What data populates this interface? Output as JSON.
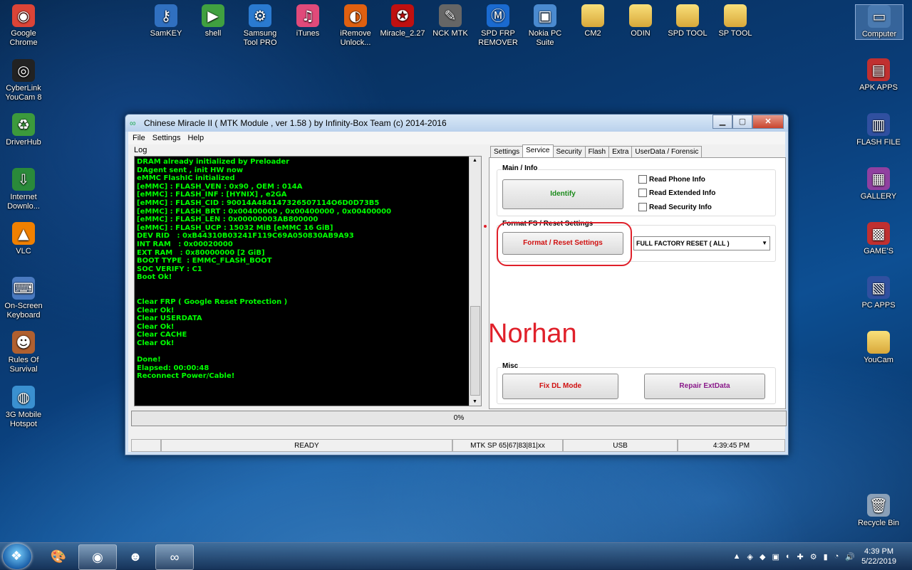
{
  "desktop": {
    "left_icons": [
      {
        "label": "Google Chrome",
        "glyph": "◉",
        "color": "#db4437"
      },
      {
        "label": "CyberLink YouCam 8",
        "glyph": "◎",
        "color": "#222"
      },
      {
        "label": "DriverHub",
        "glyph": "♻",
        "color": "#3c9a3c"
      },
      {
        "label": "Internet Downlo...",
        "glyph": "⇩",
        "color": "#2a8a3a"
      },
      {
        "label": "VLC",
        "glyph": "▲",
        "color": "#f08000"
      },
      {
        "label": "On-Screen Keyboard",
        "glyph": "⌨",
        "color": "#4a7ac0"
      },
      {
        "label": "Rules Of Survival",
        "glyph": "☻",
        "color": "#b06030"
      },
      {
        "label": "3G Mobile Hotspot",
        "glyph": "◍",
        "color": "#3a90d0"
      }
    ],
    "top_icons": [
      {
        "label": "SamKEY",
        "glyph": "⚷",
        "color": "#3070c0"
      },
      {
        "label": "shell",
        "glyph": "▶",
        "color": "#40a040"
      },
      {
        "label": "Samsung Tool PRO",
        "glyph": "⚙",
        "color": "#2a7ad0"
      },
      {
        "label": "iTunes",
        "glyph": "♫",
        "color": "#e04a7a"
      },
      {
        "label": "iRemove Unlock...",
        "glyph": "◐",
        "color": "#e06010"
      },
      {
        "label": "Miracle_2.27",
        "glyph": "✪",
        "color": "#c01010"
      },
      {
        "label": "NCK MTK",
        "glyph": "✎",
        "color": "#666"
      },
      {
        "label": "SPD FRP REMOVER",
        "glyph": "Ⓜ",
        "color": "#1a6ad0"
      },
      {
        "label": "Nokia PC Suite",
        "glyph": "▣",
        "color": "#4a8ad0"
      },
      {
        "label": "CM2",
        "glyph": "",
        "color": "folder"
      },
      {
        "label": "ODIN",
        "glyph": "",
        "color": "folder"
      },
      {
        "label": "SPD TOOL",
        "glyph": "",
        "color": "folder"
      },
      {
        "label": "SP TOOL",
        "glyph": "",
        "color": "folder"
      }
    ],
    "right_icons": [
      {
        "label": "Computer",
        "glyph": "▭",
        "color": "#4a7ab0"
      },
      {
        "label": "APK APPS",
        "glyph": "▤",
        "color": "#c03030"
      },
      {
        "label": "FLASH FILE",
        "glyph": "▥",
        "color": "#3050a0"
      },
      {
        "label": "GALLERY",
        "glyph": "▦",
        "color": "#9040a0"
      },
      {
        "label": "GAME'S",
        "glyph": "▩",
        "color": "#c03030"
      },
      {
        "label": "PC APPS",
        "glyph": "▧",
        "color": "#3050a0"
      },
      {
        "label": "YouCam",
        "glyph": "",
        "color": "folder"
      },
      {
        "label": "Recycle Bin",
        "glyph": "🗑",
        "color": "#8aa0b8"
      }
    ]
  },
  "window": {
    "title": "Chinese Miracle II ( MTK Module , ver 1.58 ) by Infinity-Box Team (c) 2014-2016",
    "menu": [
      "File",
      "Settings",
      "Help"
    ],
    "log_label": "Log",
    "log_lines": [
      "DRAM already initialized by Preloader",
      "DAgent sent , init HW now",
      "eMMC FlashIC initialized",
      "[eMMC] : FLASH_VEN : 0x90 , OEM : 014A",
      "[eMMC] : FLASH_INF : [HYNIX] , e2GA",
      "[eMMC] : FLASH_CID : 90014A484147326507114O6D0D73B5",
      "[eMMC] : FLASH_BRT : 0x00400000 , 0x00400000 , 0x00400000",
      "[eMMC] : FLASH_LEN : 0x00000003AB800000",
      "[eMMC] : FLASH_UCP : 15032 MiB [eMMC 16 GiB]",
      "DEV RID   : 0xB44310B03241F119C69A050830AB9A93",
      "INT RAM   : 0x00020000",
      "EXT RAM   : 0x80000000 [2 GiB]",
      "BOOT TYPE  : EMMC_FLASH_BOOT",
      "SOC VERIFY : C1",
      "Boot Ok!",
      "",
      "",
      "Clear FRP ( Google Reset Protection )",
      "Clear Ok!",
      "Clear USERDATA",
      "Clear Ok!",
      "Clear CACHE",
      "Clear Ok!",
      "",
      "Done!",
      "Elapsed: 00:00:48",
      "Reconnect Power/Cable!"
    ],
    "tabs": [
      "Settings",
      "Service",
      "Security",
      "Flash",
      "Extra",
      "UserData / Forensic"
    ],
    "active_tab": "Service",
    "main_info": {
      "group_label": "Main / Info",
      "identify_label": "Identify",
      "checks": [
        "Read Phone Info",
        "Read Extended Info",
        "Read Security Info"
      ]
    },
    "format": {
      "group_label": "Format FS / Reset Settings",
      "button_label": "Format / Reset Settings",
      "selected_option": "FULL FACTORY RESET ( ALL )"
    },
    "misc": {
      "group_label": "Misc",
      "fix_label": "Fix DL Mode",
      "repair_label": "Repair ExtData"
    },
    "progress": {
      "text": "0%",
      "value": 0
    },
    "status": [
      "READY",
      "MTK SP 65|67|83|81|xx",
      "USB",
      "4:39:45 PM"
    ],
    "annotation_text": "Norhan",
    "annotation_color": "#e0202a"
  },
  "taskbar": {
    "time": "4:39 PM",
    "date": "5/22/2019",
    "tray_glyphs": [
      "▲",
      "◈",
      "◆",
      "▣",
      "◐",
      "✚",
      "⚙",
      "▮",
      "◔",
      "🔊"
    ]
  }
}
